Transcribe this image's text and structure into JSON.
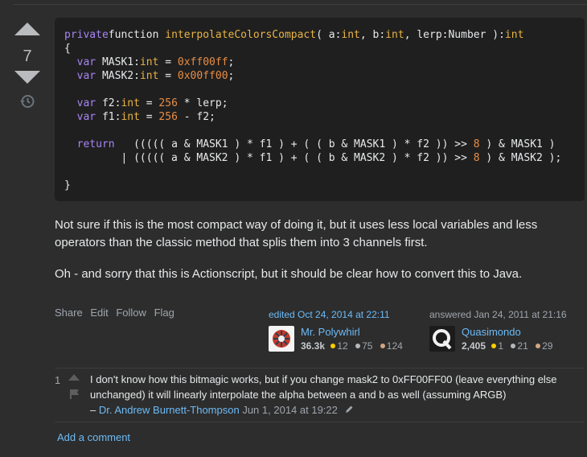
{
  "vote": {
    "score": "7"
  },
  "code": {
    "lines": [
      [
        [
          "kw",
          "private"
        ],
        [
          "",
          "function "
        ],
        [
          "fn",
          "interpolateColorsCompact"
        ],
        [
          "",
          "( a:"
        ],
        [
          "ty",
          "int"
        ],
        [
          "",
          ", b:"
        ],
        [
          "ty",
          "int"
        ],
        [
          "",
          ", lerp:Number ):"
        ],
        [
          "ty",
          "int"
        ]
      ],
      [
        [
          "",
          "{"
        ]
      ],
      [
        [
          "",
          "  "
        ],
        [
          "kw",
          "var"
        ],
        [
          "",
          " MASK1:"
        ],
        [
          "ty",
          "int"
        ],
        [
          "",
          " = "
        ],
        [
          "num",
          "0xff00ff"
        ],
        [
          "",
          ";"
        ]
      ],
      [
        [
          "",
          "  "
        ],
        [
          "kw",
          "var"
        ],
        [
          "",
          " MASK2:"
        ],
        [
          "ty",
          "int"
        ],
        [
          "",
          " = "
        ],
        [
          "num",
          "0x00ff00"
        ],
        [
          "",
          ";"
        ]
      ],
      [
        [
          "",
          ""
        ]
      ],
      [
        [
          "",
          "  "
        ],
        [
          "kw",
          "var"
        ],
        [
          "",
          " f2:"
        ],
        [
          "ty",
          "int"
        ],
        [
          "",
          " = "
        ],
        [
          "num",
          "256"
        ],
        [
          "",
          " * lerp;"
        ]
      ],
      [
        [
          "",
          "  "
        ],
        [
          "kw",
          "var"
        ],
        [
          "",
          " f1:"
        ],
        [
          "ty",
          "int"
        ],
        [
          "",
          " = "
        ],
        [
          "num",
          "256"
        ],
        [
          "",
          " - f2;"
        ]
      ],
      [
        [
          "",
          ""
        ]
      ],
      [
        [
          "",
          "  "
        ],
        [
          "kw",
          "return"
        ],
        [
          "",
          "   ((((( a & MASK1 ) * f1 ) + ( ( b & MASK1 ) * f2 )) >> "
        ],
        [
          "num",
          "8"
        ],
        [
          "",
          " ) & MASK1 )"
        ]
      ],
      [
        [
          "",
          "         | ((((( a & MASK2 ) * f1 ) + ( ( b & MASK2 ) * f2 )) >> "
        ],
        [
          "num",
          "8"
        ],
        [
          "",
          " ) & MASK2 );"
        ]
      ],
      [
        [
          "",
          ""
        ]
      ],
      [
        [
          "",
          "}"
        ]
      ]
    ]
  },
  "body": {
    "p1": "Not sure if this is the most compact way of doing it, but it uses less local variables and less operators than the classic method that splis them into 3 channels first.",
    "p2": "Oh - and sorry that this is Actionscript, but it should be clear how to convert this to Java."
  },
  "menu": {
    "share": "Share",
    "edit": "Edit",
    "follow": "Follow",
    "flag": "Flag"
  },
  "editor": {
    "action": "edited Oct 24, 2014 at 22:11",
    "name": "Mr. Polywhirl",
    "rep": "36.3k",
    "gold": "12",
    "silver": "75",
    "bronze": "124"
  },
  "author": {
    "action": "answered Jan 24, 2011 at 21:16",
    "name": "Quasimondo",
    "rep": "2,405",
    "gold": "1",
    "silver": "21",
    "bronze": "29"
  },
  "comment": {
    "score": "1",
    "text": "I don't know how this bitmagic works, but if you change mask2 to 0xFF00FF00 (leave everything else unchanged) it will linearly interpolate the alpha between a and b as well (assuming ARGB)",
    "dash": "– ",
    "user": "Dr. Andrew Burnett-Thompson",
    "date": "Jun 1, 2014 at 19:22"
  },
  "add_comment": "Add a comment"
}
